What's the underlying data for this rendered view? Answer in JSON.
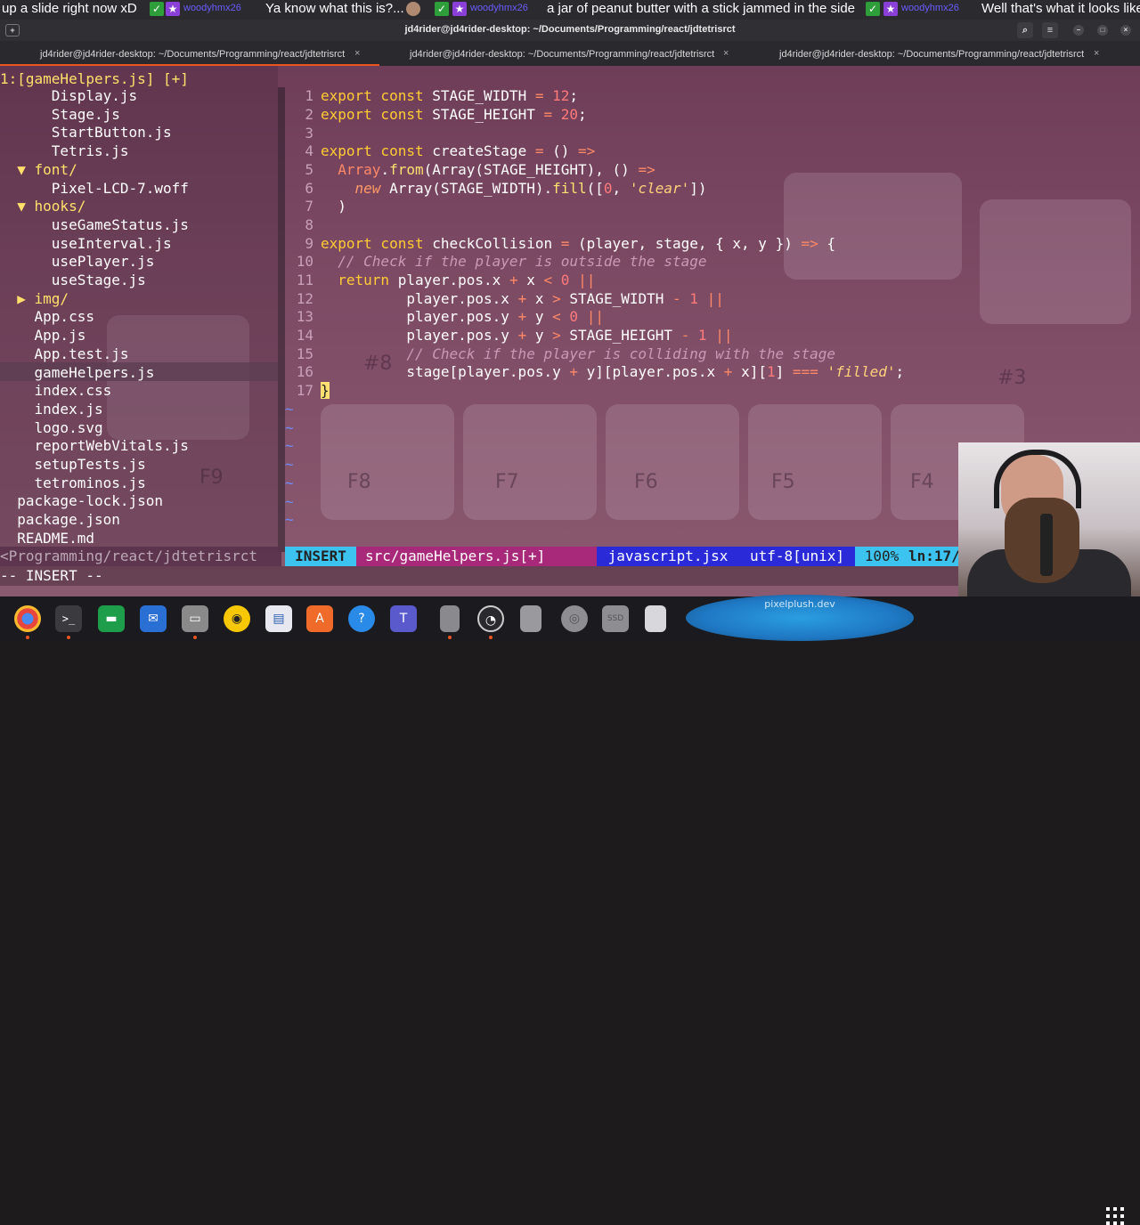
{
  "ticker": {
    "seg1": "up a slide right now xD",
    "user1": "woodyhmx26",
    "msg1": "Ya know what this is?...",
    "user2": "woodyhmx26",
    "msg2": "a jar of peanut butter with a stick jammed in the side",
    "user3": "woodyhmx26",
    "msg3": "Well that's what it looks like"
  },
  "window": {
    "title": "jd4rider@jd4rider-desktop: ~/Documents/Programming/react/jdtetrisrct"
  },
  "tabs": [
    {
      "label": "jd4rider@jd4rider-desktop: ~/Documents/Programming/react/jdtetrisrct",
      "close": "×"
    },
    {
      "label": "jd4rider@jd4rider-desktop: ~/Documents/Programming/react/jdtetrisrct",
      "close": "×"
    },
    {
      "label": "jd4rider@jd4rider-desktop: ~/Documents/Programming/react/jdtetrisrct",
      "close": "×"
    }
  ],
  "tree": {
    "header": "1:[gameHelpers.js] [+]",
    "items": [
      {
        "text": "      Display.js",
        "dir": false
      },
      {
        "text": "      Stage.js",
        "dir": false
      },
      {
        "text": "      StartButton.js",
        "dir": false
      },
      {
        "text": "      Tetris.js",
        "dir": false
      },
      {
        "text": "  ▼ font/",
        "dir": true
      },
      {
        "text": "      Pixel-LCD-7.woff",
        "dir": false
      },
      {
        "text": "  ▼ hooks/",
        "dir": true
      },
      {
        "text": "      useGameStatus.js",
        "dir": false
      },
      {
        "text": "      useInterval.js",
        "dir": false
      },
      {
        "text": "      usePlayer.js",
        "dir": false
      },
      {
        "text": "      useStage.js",
        "dir": false
      },
      {
        "text": "  ▶ img/",
        "dir": true
      },
      {
        "text": "    App.css",
        "dir": false
      },
      {
        "text": "    App.js",
        "dir": false
      },
      {
        "text": "    App.test.js",
        "dir": false
      },
      {
        "text": "    gameHelpers.js",
        "dir": false
      },
      {
        "text": "    index.css",
        "dir": false
      },
      {
        "text": "    index.js",
        "dir": false
      },
      {
        "text": "    logo.svg",
        "dir": false
      },
      {
        "text": "    reportWebVitals.js",
        "dir": false
      },
      {
        "text": "    setupTests.js",
        "dir": false
      },
      {
        "text": "    tetrominos.js",
        "dir": false
      },
      {
        "text": "  package-lock.json",
        "dir": false
      },
      {
        "text": "  package.json",
        "dir": false
      },
      {
        "text": "  README.md",
        "dir": false
      }
    ],
    "cwd": "<Programming/react/jdtetrisrct"
  },
  "code": {
    "lines": [
      {
        "n": "1",
        "t": "export const STAGE_WIDTH = 12;"
      },
      {
        "n": "2",
        "t": "export const STAGE_HEIGHT = 20;"
      },
      {
        "n": "3",
        "t": ""
      },
      {
        "n": "4",
        "t": "export const createStage = () =>"
      },
      {
        "n": "5",
        "t": "  Array.from(Array(STAGE_HEIGHT), () =>"
      },
      {
        "n": "6",
        "t": "    new Array(STAGE_WIDTH).fill([0, 'clear'])"
      },
      {
        "n": "7",
        "t": "  )"
      },
      {
        "n": "8",
        "t": ""
      },
      {
        "n": "9",
        "t": "export const checkCollision = (player, stage, { x, y }) => {"
      },
      {
        "n": "10",
        "t": "  // Check if the player is outside the stage"
      },
      {
        "n": "11",
        "t": "  return player.pos.x + x < 0 ||"
      },
      {
        "n": "12",
        "t": "          player.pos.x + x > STAGE_WIDTH - 1 ||"
      },
      {
        "n": "13",
        "t": "          player.pos.y + y < 0 ||"
      },
      {
        "n": "14",
        "t": "          player.pos.y + y > STAGE_HEIGHT - 1 ||"
      },
      {
        "n": "15",
        "t": "          // Check if the player is colliding with the stage"
      },
      {
        "n": "16",
        "t": "          stage[player.pos.y + y][player.pos.x + x][1] === 'filled';"
      },
      {
        "n": "17",
        "t": "}"
      }
    ]
  },
  "status": {
    "mode": "INSERT",
    "file": "src/gameHelpers.js[+]",
    "filetype": "javascript.jsx",
    "encoding": "utf-8[unix]",
    "percent": "100%",
    "position": "ln:17/1"
  },
  "cmdline": "-- INSERT --",
  "keys": [
    "#8",
    "F9",
    "F8",
    "F7",
    "F6",
    "F5",
    "F4",
    "#3"
  ],
  "webcam_label": "pixelplush.dev",
  "colors": {
    "accent": "#e95420",
    "statusMode": "#3cc3f0",
    "statusFile": "#a8287a",
    "statusType": "#2a2ad8"
  }
}
